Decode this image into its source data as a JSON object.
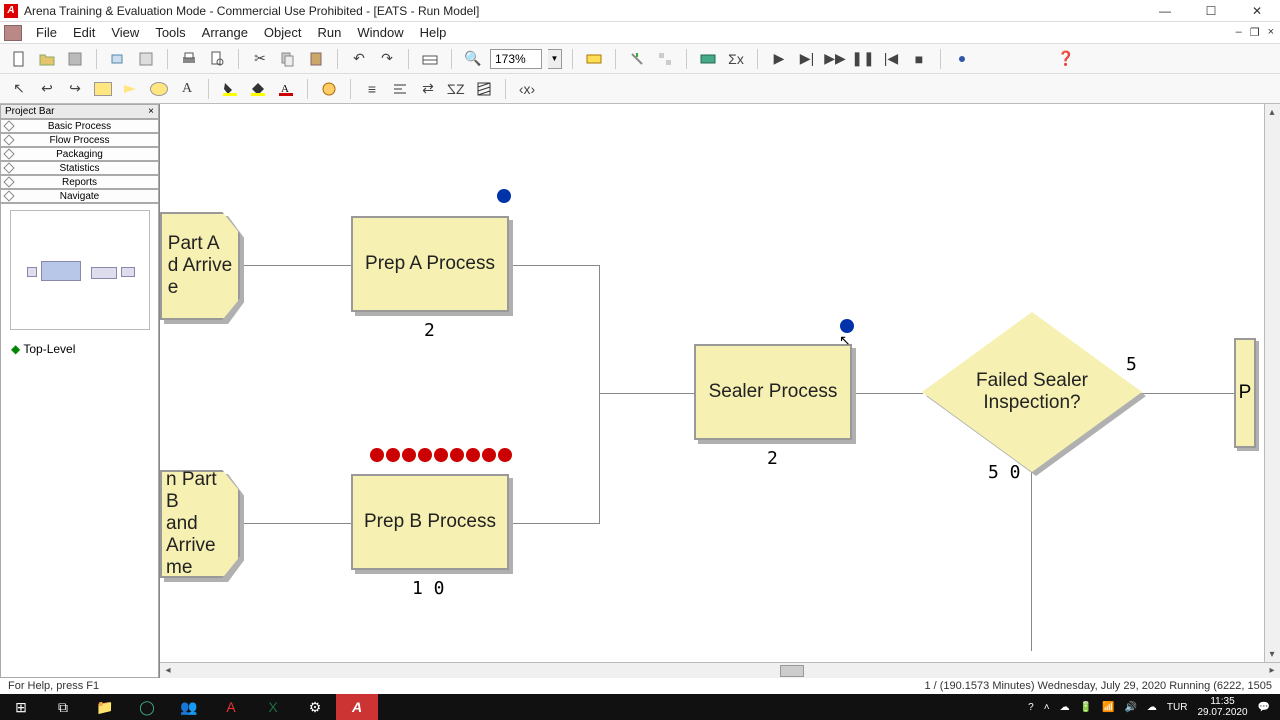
{
  "window": {
    "title": "Arena Training & Evaluation Mode - Commercial Use Prohibited - [EATS - Run Model]"
  },
  "menu": {
    "file": "File",
    "edit": "Edit",
    "view": "View",
    "tools": "Tools",
    "arrange": "Arrange",
    "object": "Object",
    "run": "Run",
    "window": "Window",
    "help": "Help"
  },
  "toolbar": {
    "zoom": "173%"
  },
  "project_bar": {
    "title": "Project Bar",
    "cats": [
      "Basic Process",
      "Flow Process",
      "Packaging",
      "Statistics",
      "Reports",
      "Navigate"
    ],
    "top_level": "Top-Level"
  },
  "model": {
    "create_a": "Part A\nd Arrive\ne",
    "create_b": "n Part B\nand Arrive\nme",
    "prep_a": "Prep A Process",
    "prep_b": "Prep B Process",
    "sealer": "Sealer Process",
    "decide": "Failed Sealer Inspection?",
    "cut_p": "P",
    "count_prep_a": "2",
    "count_prep_b": "1 0",
    "count_sealer": "2",
    "count_decide_true": "5",
    "count_decide_false": "5 0"
  },
  "status": {
    "left": "For Help, press F1",
    "right": "1 / (190.1573 Minutes) Wednesday, July 29, 2020                Running    (6222, 1505"
  },
  "tray": {
    "lang": "TUR",
    "time": "11:35",
    "date": "29.07.2020"
  }
}
